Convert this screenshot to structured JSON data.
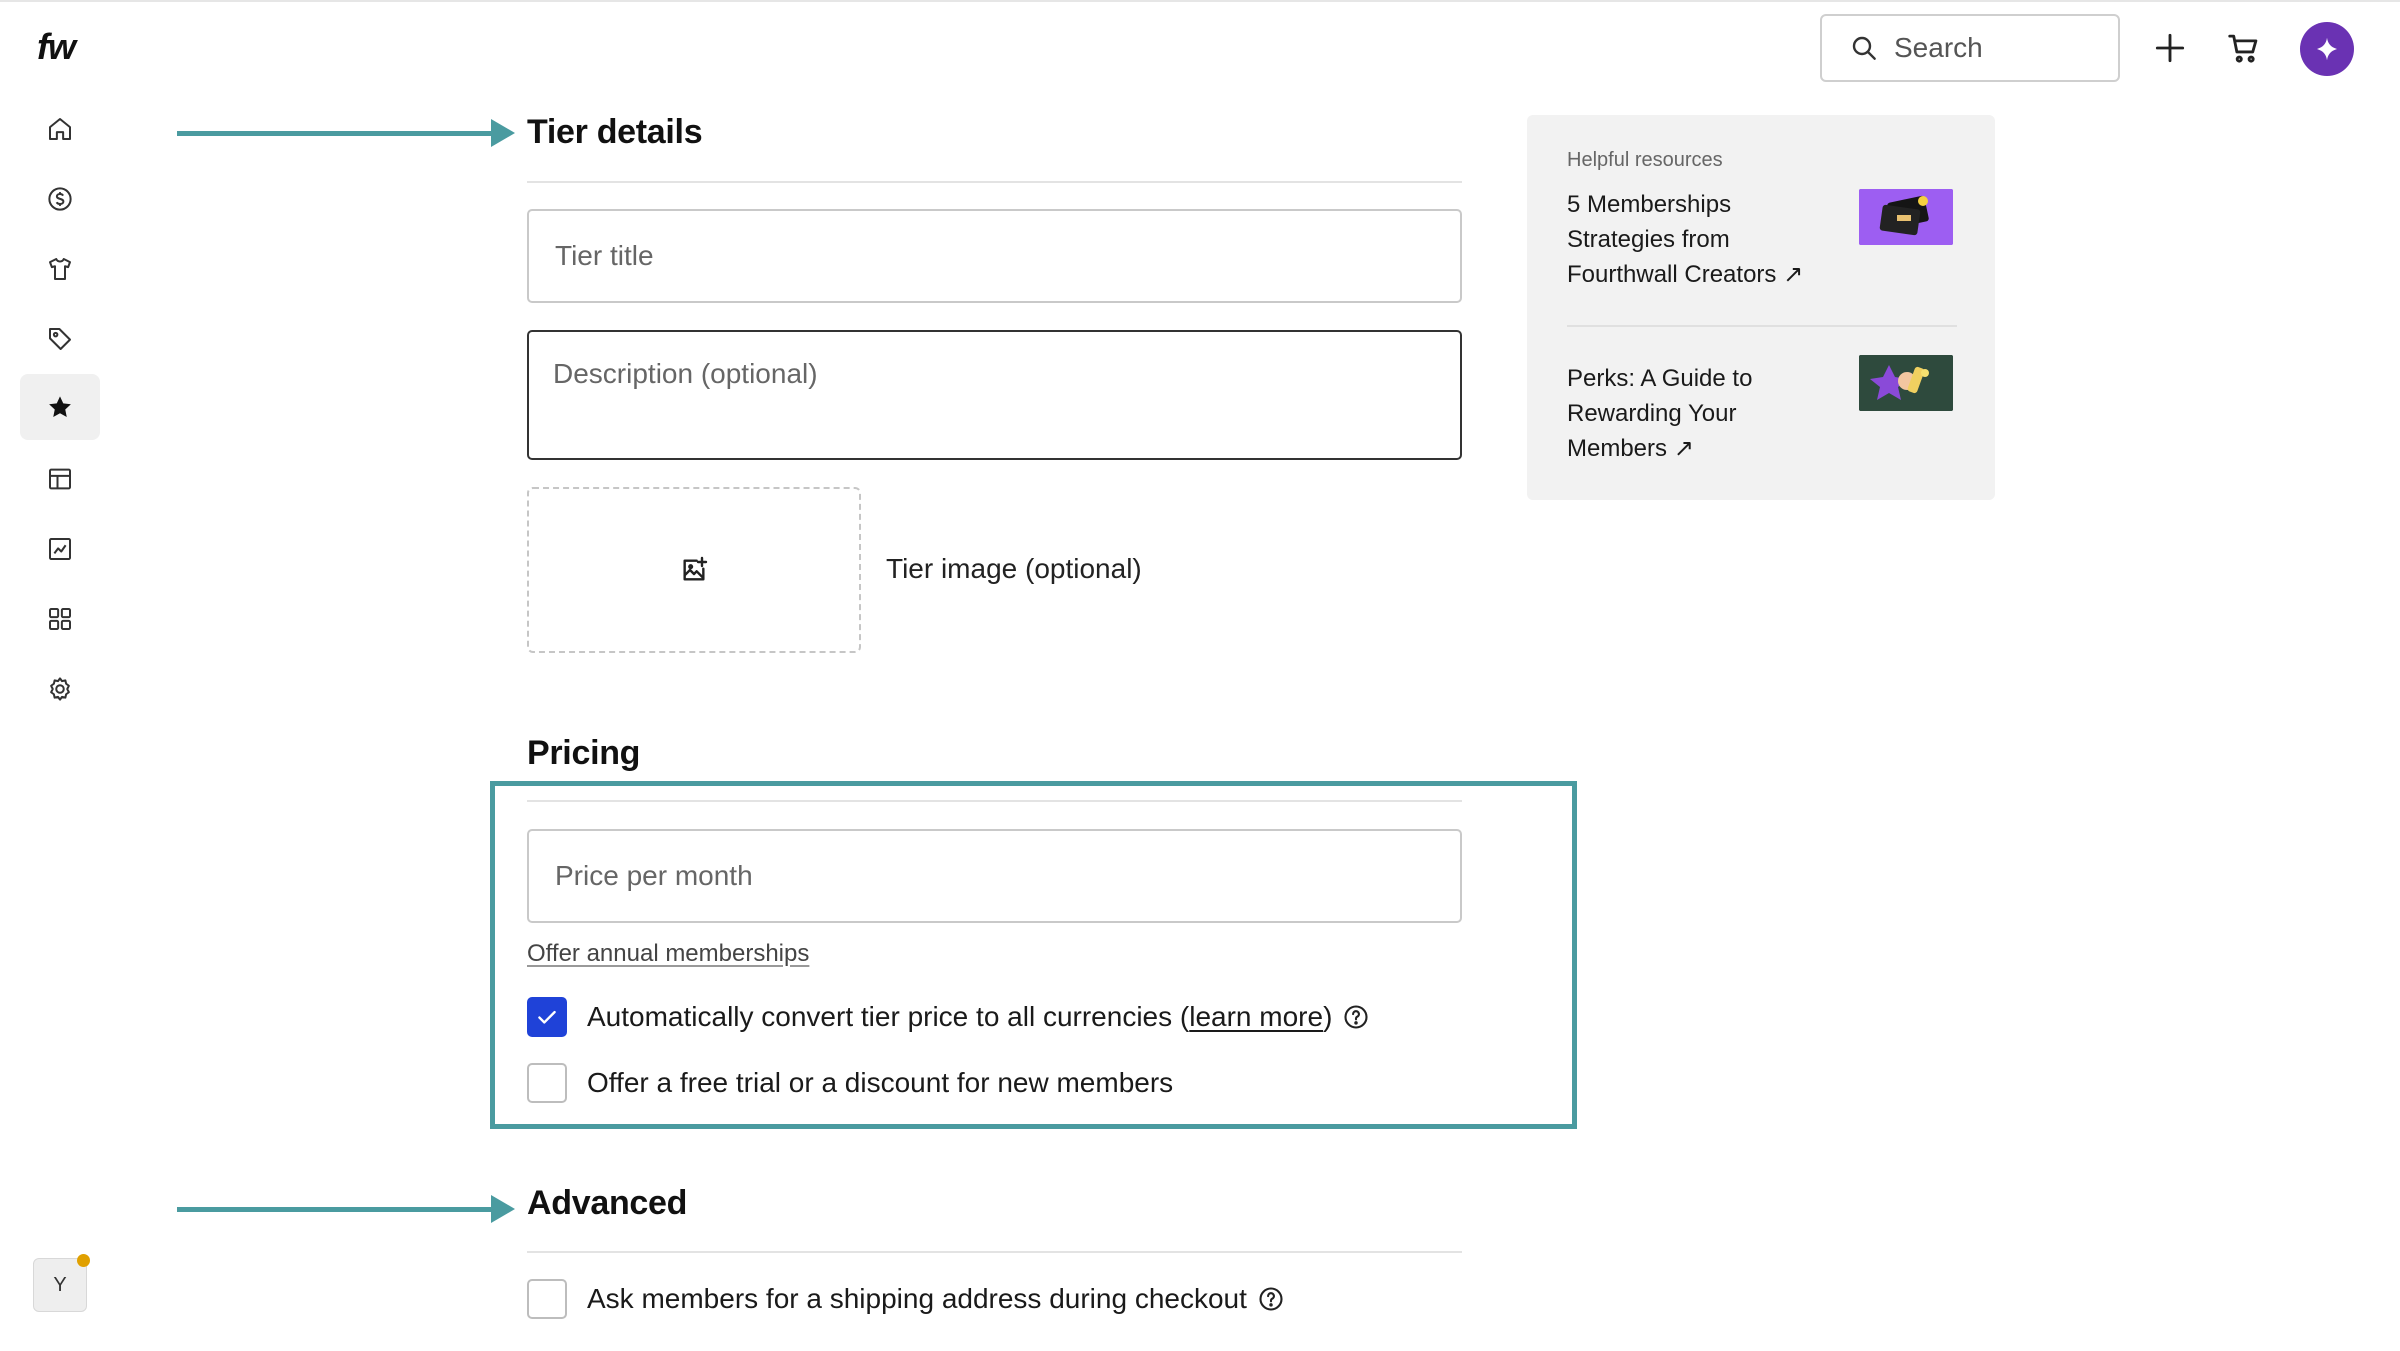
{
  "app": {
    "logo": "fw"
  },
  "sidebar": {
    "items": [
      {
        "name": "home",
        "icon": "home-icon"
      },
      {
        "name": "money",
        "icon": "dollar-icon"
      },
      {
        "name": "products",
        "icon": "shirt-icon"
      },
      {
        "name": "promotions",
        "icon": "tag-icon"
      },
      {
        "name": "memberships",
        "icon": "star-icon",
        "active": true
      },
      {
        "name": "layout",
        "icon": "table-icon"
      },
      {
        "name": "analytics",
        "icon": "chart-icon"
      },
      {
        "name": "apps",
        "icon": "grid-icon"
      },
      {
        "name": "settings",
        "icon": "gear-icon"
      }
    ],
    "user_initial": "Y"
  },
  "header": {
    "search_placeholder": "Search"
  },
  "tier_details": {
    "title": "Tier details",
    "tier_title_placeholder": "Tier title",
    "description_placeholder": "Description (optional)",
    "image_label": "Tier image (optional)"
  },
  "pricing": {
    "title": "Pricing",
    "price_placeholder": "Price per month",
    "annual_link": "Offer annual memberships",
    "auto_convert_prefix": "Automatically convert tier price to all currencies (",
    "learn_more": "learn more",
    "auto_convert_suffix": ")",
    "auto_convert_checked": true,
    "free_trial_label": "Offer a free trial or a discount for new members",
    "free_trial_checked": false
  },
  "advanced": {
    "title": "Advanced",
    "shipping_label": "Ask members for a shipping address during checkout",
    "shipping_checked": false
  },
  "resources": {
    "heading": "Helpful resources",
    "items": [
      {
        "title": "5 Memberships Strategies from Fourthwall Creators ↗"
      },
      {
        "title": "Perks: A Guide to Rewarding Your Members ↗"
      }
    ]
  },
  "colors": {
    "accent_teal": "#4a9ba0",
    "checkbox_blue": "#1f42d8",
    "ai_purple": "#6a32b3"
  }
}
